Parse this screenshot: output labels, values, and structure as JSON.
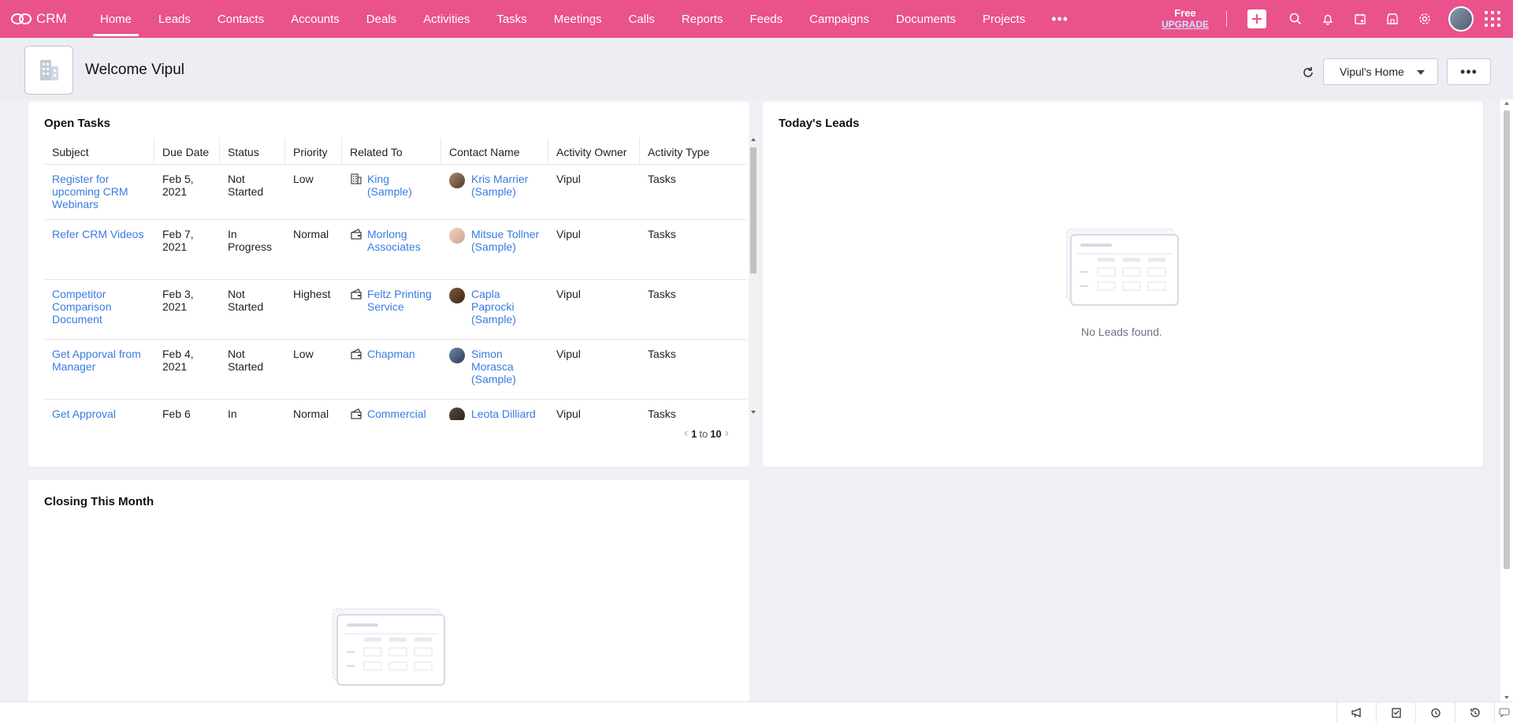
{
  "app": {
    "name": "CRM"
  },
  "nav": {
    "items": [
      {
        "label": "Home",
        "active": true
      },
      {
        "label": "Leads"
      },
      {
        "label": "Contacts"
      },
      {
        "label": "Accounts"
      },
      {
        "label": "Deals"
      },
      {
        "label": "Activities"
      },
      {
        "label": "Tasks"
      },
      {
        "label": "Meetings"
      },
      {
        "label": "Calls"
      },
      {
        "label": "Reports"
      },
      {
        "label": "Feeds"
      },
      {
        "label": "Campaigns"
      },
      {
        "label": "Documents"
      },
      {
        "label": "Projects"
      }
    ],
    "more": "•••",
    "upgrade": {
      "plan": "Free",
      "link": "UPGRADE"
    }
  },
  "header": {
    "welcome": "Welcome Vipul",
    "home_select": "Vipul's Home",
    "more_label": "•••"
  },
  "open_tasks": {
    "title": "Open Tasks",
    "columns": [
      "Subject",
      "Due Date",
      "Status",
      "Priority",
      "Related To",
      "Contact Name",
      "Activity Owner",
      "Activity Type"
    ],
    "rows": [
      {
        "subject": "Register for upcoming CRM Webinars",
        "due": "Feb 5, 2021",
        "status": "Not Started",
        "priority": "Low",
        "related": "King (Sample)",
        "related_icon": "building-icon",
        "contact": "Kris Marrier (Sample)",
        "owner": "Vipul",
        "type": "Tasks"
      },
      {
        "subject": "Refer CRM Videos",
        "due": "Feb 7, 2021",
        "status": "In Progress",
        "priority": "Normal",
        "related": "Morlong Associates",
        "related_icon": "deal-icon",
        "contact": "Mitsue Tollner (Sample)",
        "owner": "Vipul",
        "type": "Tasks"
      },
      {
        "subject": "Competitor Comparison Document",
        "due": "Feb 3, 2021",
        "status": "Not Started",
        "priority": "Highest",
        "related": "Feltz Printing Service",
        "related_icon": "deal-icon",
        "contact": "Capla Paprocki (Sample)",
        "owner": "Vipul",
        "type": "Tasks"
      },
      {
        "subject": "Get Apporval from Manager",
        "due": "Feb 4, 2021",
        "status": "Not Started",
        "priority": "Low",
        "related": "Chapman",
        "related_icon": "deal-icon",
        "contact": "Simon Morasca (Sample)",
        "owner": "Vipul",
        "type": "Tasks"
      },
      {
        "subject": "Get Approval",
        "due": "Feb 6",
        "status": "In",
        "priority": "Normal",
        "related": "Commercial",
        "related_icon": "deal-icon",
        "contact": "Leota Dilliard",
        "owner": "Vipul",
        "type": "Tasks"
      }
    ],
    "pager": {
      "from": "1",
      "sep": "to",
      "to": "10"
    }
  },
  "todays_leads": {
    "title": "Today's Leads",
    "empty": "No Leads found."
  },
  "closing": {
    "title": "Closing This Month"
  },
  "colors": {
    "brand": "#e9528b",
    "link": "#3a7be0"
  }
}
